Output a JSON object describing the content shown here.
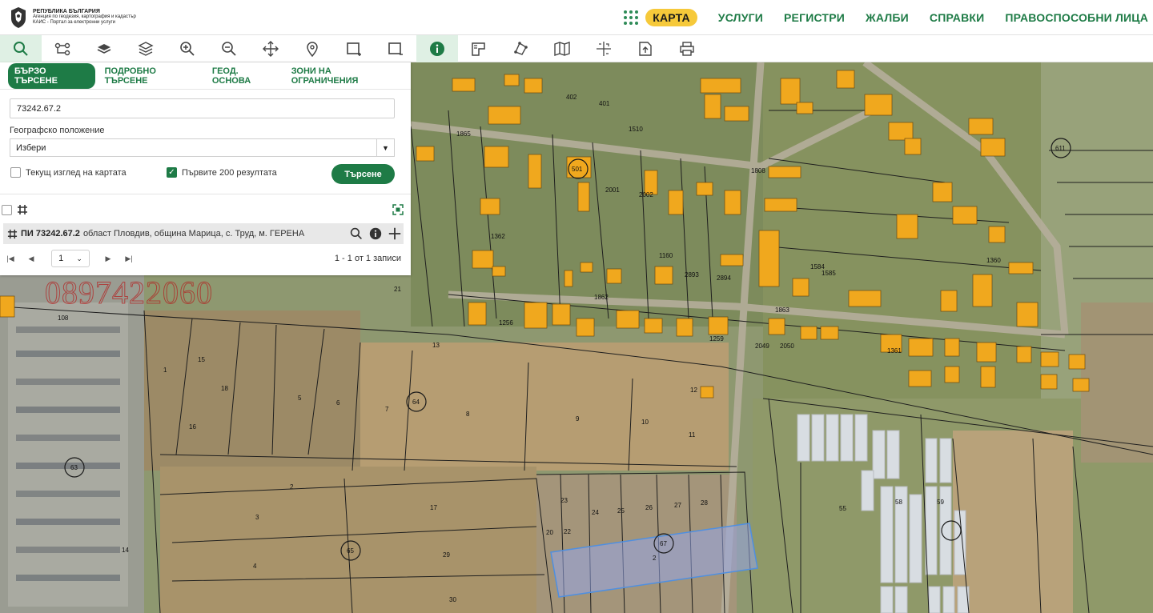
{
  "header": {
    "logo_lines": [
      "РЕПУБЛИКА БЪЛГАРИЯ",
      "Агенция по геодезия, картография и кадастър",
      "КАИС - Портал за електронни услуги"
    ],
    "nav": [
      "КАРТА",
      "УСЛУГИ",
      "РЕГИСТРИ",
      "ЖАЛБИ",
      "СПРАВКИ",
      "ПРАВОСПОСОБНИ ЛИЦА"
    ],
    "active_nav": "КАРТА"
  },
  "toolbar": {
    "tools": [
      "search-icon",
      "connect-icon",
      "layer-icon",
      "layers-icon",
      "zoom-in-icon",
      "zoom-out-icon",
      "pan-icon",
      "location-pin-icon",
      "select-rectangle-icon",
      "deselect-rectangle-icon",
      "info-icon",
      "area-measure-icon",
      "polygon-icon",
      "map-icon",
      "coordinate-icon",
      "export-icon",
      "print-icon"
    ]
  },
  "panel": {
    "tabs": [
      "БЪРЗО ТЪРСЕНЕ",
      "ПОДРОБНО ТЪРСЕНЕ",
      "ГЕОД. ОСНОВА",
      "ЗОНИ НА ОГРАНИЧЕНИЯ"
    ],
    "query_value": "73242.67.2",
    "geo_label": "Географско положение",
    "geo_select": "Избери",
    "current_view_label": "Текущ изглед на картата",
    "first200_label": "Първите 200 резултата",
    "search_button": "Търсене",
    "result": {
      "id": "ПИ 73242.67.2",
      "description": "област Пловдив, община Марица, с. Труд, м. ГЕРЕНА"
    },
    "pager": {
      "page": "1",
      "info": "1 - 1 от 1 записи"
    }
  },
  "map": {
    "watermark": "0897422060",
    "accent_building": "#f0a81e",
    "highlight": "#4f8fe0",
    "labels": [
      "501",
      "1865",
      "1862",
      "1863",
      "64",
      "63",
      "65",
      "67",
      "55",
      "58",
      "59",
      "611",
      "1808",
      "1510",
      "2001",
      "2002",
      "2893",
      "2894",
      "1160",
      "1256",
      "1259",
      "1584",
      "1585",
      "1360",
      "2049",
      "2050",
      "1361",
      "1362",
      "401",
      "402",
      "13",
      "108",
      "18",
      "16",
      "15",
      "21",
      "17",
      "29",
      "30",
      "14",
      "23",
      "24",
      "25",
      "26",
      "27",
      "28",
      "22",
      "1",
      "2",
      "3",
      "4",
      "5",
      "6",
      "7",
      "8",
      "9",
      "10",
      "11",
      "12",
      "20"
    ],
    "highlight_label": "2"
  },
  "colors": {
    "brand_green": "#1e7b46",
    "nav_active_bg": "#f6c93a"
  }
}
